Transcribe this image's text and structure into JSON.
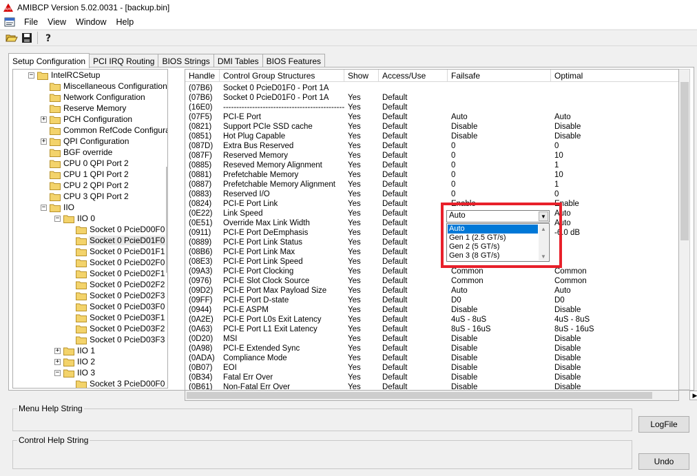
{
  "window": {
    "title": "AMIBCP Version 5.02.0031 - [backup.bin]"
  },
  "menu": [
    "File",
    "View",
    "Window",
    "Help"
  ],
  "tabs": [
    "Setup Configuration",
    "PCI IRQ Routing",
    "BIOS Strings",
    "DMI Tables",
    "BIOS Features"
  ],
  "tree": [
    {
      "label": "IntelRCSetup",
      "level": 0,
      "expander": "−"
    },
    {
      "label": "Miscellaneous Configuration",
      "level": 1,
      "expander": ""
    },
    {
      "label": "Network Configuration",
      "level": 1,
      "expander": ""
    },
    {
      "label": "Reserve Memory",
      "level": 1,
      "expander": ""
    },
    {
      "label": "PCH Configuration",
      "level": 1,
      "expander": "+"
    },
    {
      "label": "Common RefCode Configurati",
      "level": 1,
      "expander": ""
    },
    {
      "label": "QPI Configuration",
      "level": 1,
      "expander": "+"
    },
    {
      "label": "BGF override",
      "level": 1,
      "expander": ""
    },
    {
      "label": "CPU 0 QPI Port 2",
      "level": 1,
      "expander": ""
    },
    {
      "label": "CPU 1 QPI Port 2",
      "level": 1,
      "expander": ""
    },
    {
      "label": "CPU 2 QPI Port 2",
      "level": 1,
      "expander": ""
    },
    {
      "label": "CPU 3 QPI Port 2",
      "level": 1,
      "expander": ""
    },
    {
      "label": "IIO",
      "level": 1,
      "expander": "−"
    },
    {
      "label": "IIO 0",
      "level": 2,
      "expander": "−"
    },
    {
      "label": "Socket 0 PcieD00F0",
      "level": 3,
      "expander": ""
    },
    {
      "label": "Socket 0 PcieD01F0",
      "level": 3,
      "expander": "",
      "selected": true
    },
    {
      "label": "Socket 0 PcieD01F1",
      "level": 3,
      "expander": ""
    },
    {
      "label": "Socket 0 PcieD02F0",
      "level": 3,
      "expander": ""
    },
    {
      "label": "Socket 0 PcieD02F1",
      "level": 3,
      "expander": ""
    },
    {
      "label": "Socket 0 PcieD02F2",
      "level": 3,
      "expander": ""
    },
    {
      "label": "Socket 0 PcieD02F3",
      "level": 3,
      "expander": ""
    },
    {
      "label": "Socket 0 PcieD03F0",
      "level": 3,
      "expander": ""
    },
    {
      "label": "Socket 0 PcieD03F1",
      "level": 3,
      "expander": ""
    },
    {
      "label": "Socket 0 PcieD03F2",
      "level": 3,
      "expander": ""
    },
    {
      "label": "Socket 0 PcieD03F3",
      "level": 3,
      "expander": ""
    },
    {
      "label": "IIO 1",
      "level": 2,
      "expander": "+"
    },
    {
      "label": "IIO 2",
      "level": 2,
      "expander": "+"
    },
    {
      "label": "IIO 3",
      "level": 2,
      "expander": "−"
    },
    {
      "label": "Socket 3 PcieD00F0",
      "level": 3,
      "expander": ""
    }
  ],
  "grid": {
    "columns": [
      "Handle",
      "Control Group Structures",
      "Show",
      "Access/Use",
      "Failsafe",
      "Optimal"
    ],
    "rows": [
      [
        "(07B6)",
        "Socket 0 PcieD01F0 - Port 1A",
        "",
        "",
        "",
        ""
      ],
      [
        "(07B6)",
        "Socket 0 PcieD01F0 - Port 1A",
        "Yes",
        "Default",
        "",
        ""
      ],
      [
        "(16E0)",
        "-----------------------------------------------",
        "Yes",
        "Default",
        "",
        ""
      ],
      [
        "(07F5)",
        "PCI-E Port",
        "Yes",
        "Default",
        "Auto",
        "Auto"
      ],
      [
        "(0821)",
        "Support PCIe SSD cache",
        "Yes",
        "Default",
        "Disable",
        "Disable"
      ],
      [
        "(0851)",
        "Hot Plug Capable",
        "Yes",
        "Default",
        "Disable",
        "Disable"
      ],
      [
        "(087D)",
        "Extra Bus Reserved",
        "Yes",
        "Default",
        "0",
        "0"
      ],
      [
        "(087F)",
        "Reserved Memory",
        "Yes",
        "Default",
        "0",
        "10"
      ],
      [
        "(0885)",
        "Reseved Memory Alignment",
        "Yes",
        "Default",
        "0",
        "1"
      ],
      [
        "(0881)",
        "Prefetchable Memory",
        "Yes",
        "Default",
        "0",
        "10"
      ],
      [
        "(0887)",
        "Prefetchable Memory Alignment",
        "Yes",
        "Default",
        "0",
        "1"
      ],
      [
        "(0883)",
        "Reserved I/O",
        "Yes",
        "Default",
        "0",
        "0"
      ],
      [
        "(0824)",
        "PCI-E Port Link",
        "Yes",
        "Default",
        "Enable",
        "Enable"
      ],
      [
        "(0E22)",
        "Link Speed",
        "Yes",
        "Default",
        "",
        "Auto"
      ],
      [
        "(0E51)",
        "Override Max Link Width",
        "Yes",
        "Default",
        "",
        "Auto"
      ],
      [
        "(0911)",
        "PCI-E Port DeEmphasis",
        "Yes",
        "Default",
        "",
        "-6.0 dB"
      ],
      [
        "(0889)",
        "PCI-E Port Link Status",
        "Yes",
        "Default",
        "",
        ""
      ],
      [
        "(08B6)",
        "PCI-E Port Link Max",
        "Yes",
        "Default",
        "",
        ""
      ],
      [
        "(08E3)",
        "PCI-E Port Link Speed",
        "Yes",
        "Default",
        "",
        ""
      ],
      [
        "(09A3)",
        "PCI-E Port Clocking",
        "Yes",
        "Default",
        "Common",
        "Common"
      ],
      [
        "(0976)",
        "PCI-E Slot Clock Source",
        "Yes",
        "Default",
        "Common",
        "Common"
      ],
      [
        "(09D2)",
        "PCI-E Port Max Payload Size",
        "Yes",
        "Default",
        "Auto",
        "Auto"
      ],
      [
        "(09FF)",
        "PCI-E Port D-state",
        "Yes",
        "Default",
        "D0",
        "D0"
      ],
      [
        "(0944)",
        "PCI-E ASPM",
        "Yes",
        "Default",
        "Disable",
        "Disable"
      ],
      [
        "(0A2E)",
        "PCI-E Port L0s Exit Latency",
        "Yes",
        "Default",
        "4uS - 8uS",
        "4uS - 8uS"
      ],
      [
        "(0A63)",
        "PCI-E Port L1 Exit Latency",
        "Yes",
        "Default",
        "8uS - 16uS",
        "8uS - 16uS"
      ],
      [
        "(0D20)",
        "MSI",
        "Yes",
        "Default",
        "Disable",
        "Disable"
      ],
      [
        "(0A98)",
        "PCI-E Extended Sync",
        "Yes",
        "Default",
        "Disable",
        "Disable"
      ],
      [
        "(0ADA)",
        "Compliance Mode",
        "Yes",
        "Default",
        "Disable",
        "Disable"
      ],
      [
        "(0B07)",
        "EOI",
        "Yes",
        "Default",
        "Disable",
        "Disable"
      ],
      [
        "(0B34)",
        "Fatal Err Over",
        "Yes",
        "Default",
        "Disable",
        "Disable"
      ],
      [
        "(0B61)",
        "Non-Fatal Err Over",
        "Yes",
        "Default",
        "Disable",
        "Disable"
      ]
    ]
  },
  "dropdown": {
    "value": "Auto",
    "options": [
      "Auto",
      "Gen 1 (2.5 GT/s)",
      "Gen 2 (5 GT/s)",
      "Gen 3 (8 GT/s)"
    ],
    "selected_index": 0,
    "highlight_color": "#e8202a"
  },
  "help": {
    "menu_label": "Menu Help String",
    "control_label": "Control Help String",
    "logfile_button": "LogFile",
    "undo_button": "Undo"
  }
}
